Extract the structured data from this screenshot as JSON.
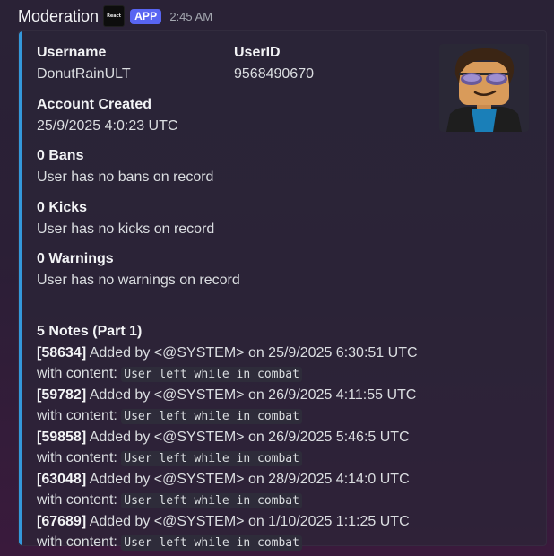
{
  "header": {
    "author": "Moderation",
    "logo_text": "React",
    "app_badge": "APP",
    "timestamp": "2:45 AM"
  },
  "embed": {
    "accent_color": "#3498db",
    "username": {
      "name": "Username",
      "value": "DonutRainULT"
    },
    "user_id": {
      "name": "UserID",
      "value": "9568490670"
    },
    "account_created": {
      "name": "Account Created",
      "value": "25/9/2025 4:0:23 UTC"
    },
    "bans": {
      "name": "0 Bans",
      "value": "User has no bans on record"
    },
    "kicks": {
      "name": "0 Kicks",
      "value": "User has no kicks on record"
    },
    "warnings": {
      "name": "0 Warnings",
      "value": "User has no warnings on record"
    },
    "notes": {
      "title": "5 Notes (Part 1)",
      "content_prefix": "with content:",
      "items": [
        {
          "id": "[58634]",
          "text": " Added by <@SYSTEM> on 25/9/2025 6:30:51 UTC with content: ",
          "content": "User left while in combat"
        },
        {
          "id": "[59782]",
          "text": " Added by <@SYSTEM> on 26/9/2025 4:11:55 UTC with content: ",
          "content": "User left while in combat"
        },
        {
          "id": "[59858]",
          "text": " Added by <@SYSTEM> on 26/9/2025 5:46:5 UTC with content: ",
          "content": "User left while in combat"
        },
        {
          "id": "[63048]",
          "text": " Added by <@SYSTEM> on 28/9/2025 4:14:0 UTC with content: ",
          "content": "User left while in combat"
        },
        {
          "id": "[67689]",
          "text": " Added by <@SYSTEM> on 1/10/2025 1:1:25 UTC with content: ",
          "content": "User left while in combat"
        }
      ]
    },
    "thumbnail_icon": "roblox-avatar-icon"
  }
}
